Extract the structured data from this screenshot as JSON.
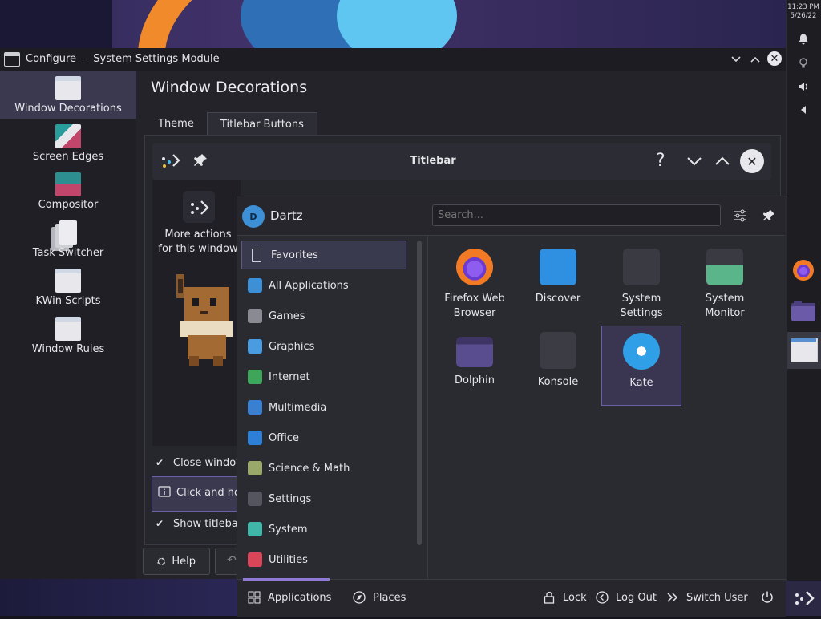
{
  "clock": {
    "time": "11:23 PM",
    "date": "5/26/22"
  },
  "window": {
    "title": "Configure — System Settings Module"
  },
  "sidebar": {
    "items": [
      {
        "label": "Window Decorations",
        "icon": "window-icon",
        "active": true
      },
      {
        "label": "Screen Edges",
        "icon": "screen-edges-icon"
      },
      {
        "label": "Compositor",
        "icon": "compositor-icon"
      },
      {
        "label": "Task Switcher",
        "icon": "task-switcher-icon"
      },
      {
        "label": "KWin Scripts",
        "icon": "kwin-scripts-icon"
      },
      {
        "label": "Window Rules",
        "icon": "window-rules-icon"
      }
    ]
  },
  "main": {
    "heading": "Window Decorations",
    "tabs": [
      {
        "label": "Theme"
      },
      {
        "label": "Titlebar Buttons",
        "active": true
      }
    ],
    "preview_title": "Titlebar",
    "more_actions": "More actions for this window",
    "checks": [
      "Close window",
      "Show titlebar"
    ],
    "info_text": "Click and ho",
    "help_label": "Help"
  },
  "launcher": {
    "user": {
      "name": "Dartz",
      "initial": "D"
    },
    "search_placeholder": "Search...",
    "categories": [
      {
        "label": "Favorites",
        "icon": "bookmark-icon",
        "color": "#d0d0d6",
        "selected": true
      },
      {
        "label": "All Applications",
        "icon": "grid-icon",
        "color": "#3d8fd6"
      },
      {
        "label": "Games",
        "icon": "gamepad-icon",
        "color": "#8a8a92"
      },
      {
        "label": "Graphics",
        "icon": "graphics-icon",
        "color": "#4a9be0"
      },
      {
        "label": "Internet",
        "icon": "globe-icon",
        "color": "#3fa55a"
      },
      {
        "label": "Multimedia",
        "icon": "multimedia-icon",
        "color": "#3a7fd0"
      },
      {
        "label": "Office",
        "icon": "office-icon",
        "color": "#2d7fd8"
      },
      {
        "label": "Science & Math",
        "icon": "flask-icon",
        "color": "#9aa86a"
      },
      {
        "label": "Settings",
        "icon": "settings-icon",
        "color": "#555560"
      },
      {
        "label": "System",
        "icon": "system-icon",
        "color": "#3fb6a8"
      },
      {
        "label": "Utilities",
        "icon": "toolbox-icon",
        "color": "#d9465a"
      }
    ],
    "apps": [
      {
        "label": "Firefox Web Browser",
        "icon": "firefox-icon",
        "color": "#f27a25"
      },
      {
        "label": "Discover",
        "icon": "discover-icon",
        "color": "#2f8fe0"
      },
      {
        "label": "System Settings",
        "icon": "system-settings-icon",
        "color": "#3a3a42"
      },
      {
        "label": "System Monitor",
        "icon": "system-monitor-icon",
        "color": "#5bb58a"
      },
      {
        "label": "Dolphin",
        "icon": "folder-icon",
        "color": "#5a4d8f"
      },
      {
        "label": "Konsole",
        "icon": "terminal-icon",
        "color": "#3c3c44"
      },
      {
        "label": "Kate",
        "icon": "kate-icon",
        "color": "#2f9fe8",
        "selected": true
      }
    ],
    "footer": {
      "applications": "Applications",
      "places": "Places",
      "lock": "Lock",
      "logout": "Log Out",
      "switch_user": "Switch User"
    }
  }
}
